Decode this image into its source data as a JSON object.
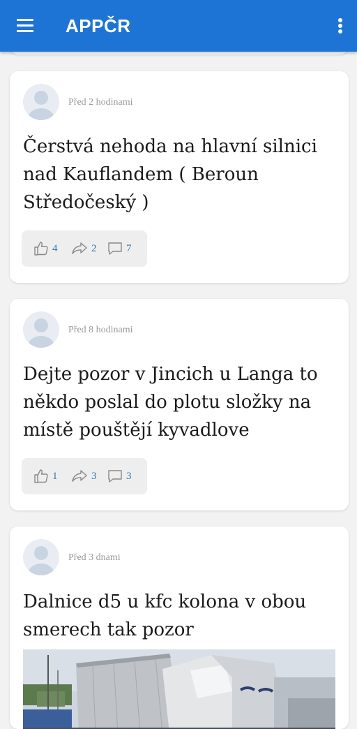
{
  "appbar": {
    "title": "APPČR",
    "menu_icon": "hamburger-menu-icon",
    "more_icon": "more-vertical-icon",
    "color": "#1e74d4"
  },
  "posts": [
    {
      "time": "Před 2 hodinami",
      "title": "Čerstvá nehoda na hlavní silnici nad Kauflandem ( Beroun Středočeský )",
      "likes": "4",
      "shares": "2",
      "comments": "7"
    },
    {
      "time": "Před 8 hodinami",
      "title": "Dejte pozor v Jincich u Langa to někdo poslal do plotu složky na místě pouštějí kyvadlove",
      "likes": "1",
      "shares": "3",
      "comments": "3"
    },
    {
      "time": "Před 3 dnami",
      "title": "Dalnice d5 u kfc kolona v obou smerech tak pozor"
    }
  ],
  "icons": {
    "like": "thumbs-up-icon",
    "share": "share-arrow-icon",
    "comment": "comment-bubble-icon"
  },
  "colors": {
    "count_text": "#2f78b6",
    "timestamp_text": "#9a9a9a"
  }
}
